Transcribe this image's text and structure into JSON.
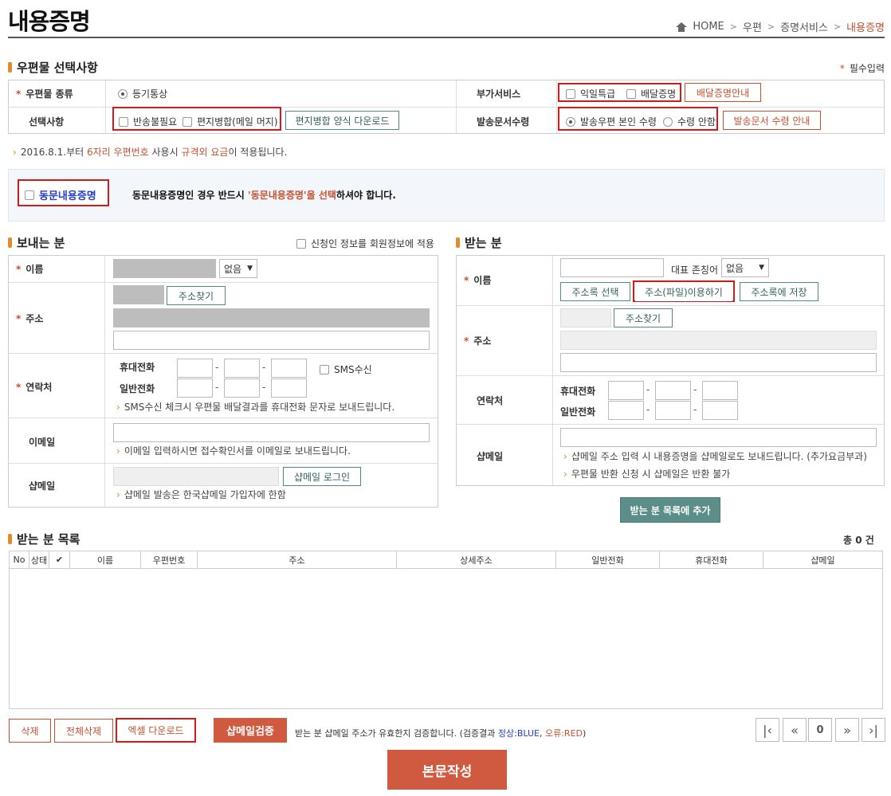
{
  "header": {
    "title": "내용증명",
    "breadcrumb": [
      "HOME",
      "우편",
      "증명서비스",
      "내용증명"
    ]
  },
  "mail_section": {
    "title": "우편물 선택사항",
    "required_note": "필수입력",
    "mail_type_label": "우편물 종류",
    "mail_type_value": "등기통상",
    "extra_service_label": "부가서비스",
    "extra_next_day": "익일특급",
    "extra_delivery_proof": "배달증명",
    "delivery_proof_guide_btn": "배달증명안내",
    "options_label": "선택사항",
    "opt_no_return": "반송불필요",
    "opt_merge": "편지병합(메일 머지)",
    "merge_form_btn": "편지병합 양식 다운로드",
    "receipt_label": "발송문서수령",
    "receipt_self": "발송우편 본인 수령",
    "receipt_none": "수령 안함",
    "receipt_guide_btn": "발송문서 수령 안내",
    "notice_pre": "2016.8.1.부터 ",
    "notice_h1": "6자리 우편번호",
    "notice_mid": " 사용시 ",
    "notice_h2": "규격외 요금",
    "notice_post": "이 적용됩니다."
  },
  "same_content": {
    "checkbox_label": "동문내용증명",
    "msg_pre": "동문내용증명인 경우 반드시 ",
    "msg_hi": "'동문내용증명'을 선택",
    "msg_post": "하셔야 합니다."
  },
  "sender": {
    "title": "보내는 분",
    "apply_member": "신청인 정보를 회원정보에 적용",
    "name_label": "이름",
    "title_select": "없음",
    "addr_label": "주소",
    "addr_search_btn": "주소찾기",
    "contact_label": "연락처",
    "mobile_label": "휴대전화",
    "phone_label": "일반전화",
    "sms_label": "SMS수신",
    "sms_note": "SMS수신 체크시 우편물 배달결과를 휴대전화 문자로 보내드립니다.",
    "email_label": "이메일",
    "email_note": "이메일 입력하시면 접수확인서를 이메일로 보내드립니다.",
    "shop_label": "샵메일",
    "shop_login_btn": "샵메일 로그인",
    "shop_note": "샵메일 발송은 한국샵메일 가입자에 한함"
  },
  "receiver": {
    "title": "받는 분",
    "name_label": "이름",
    "honorific_label": "대표 존칭어",
    "honorific_select": "없음",
    "addrbook_select_btn": "주소록 선택",
    "addr_file_btn": "주소(파일)이용하기",
    "addrbook_save_btn": "주소록에 저장",
    "addr_label": "주소",
    "addr_search_btn": "주소찾기",
    "contact_label": "연락처",
    "mobile_label": "휴대전화",
    "phone_label": "일반전화",
    "shop_label": "샵메일",
    "shop_note1": "샵메일 주소 입력 시 내용증명을 샵메일로도 보내드립니다. (추가요금부과)",
    "shop_note2": "우편물 반환 신청 시 샵메일은 반환 불가",
    "add_btn": "받는 분 목록에 추가"
  },
  "list": {
    "title": "받는 분 목록",
    "total": "총 0 건",
    "columns": [
      "No",
      "상태",
      "",
      "이름",
      "우편번호",
      "주소",
      "상세주소",
      "일반전화",
      "휴대전화",
      "샵메일"
    ]
  },
  "bottom": {
    "delete_btn": "삭제",
    "delete_all_btn": "전체삭제",
    "excel_btn": "엑셀 다운로드",
    "shop_verify_btn": "샵메일검증",
    "verify_note_pre": "받는 분 샵메일 주소가 유효한지 검증합니다. (검증결과 ",
    "verify_ok": "정상:BLUE",
    "verify_sep": ", ",
    "verify_err": "오류:RED",
    "verify_note_post": ")",
    "page_value": "0",
    "write_btn": "본문작성"
  },
  "colors": {
    "accent": "#c5512f",
    "teal": "#5b8e89",
    "highlight_box": "#d01b1b",
    "blue_label": "#2440c8"
  }
}
